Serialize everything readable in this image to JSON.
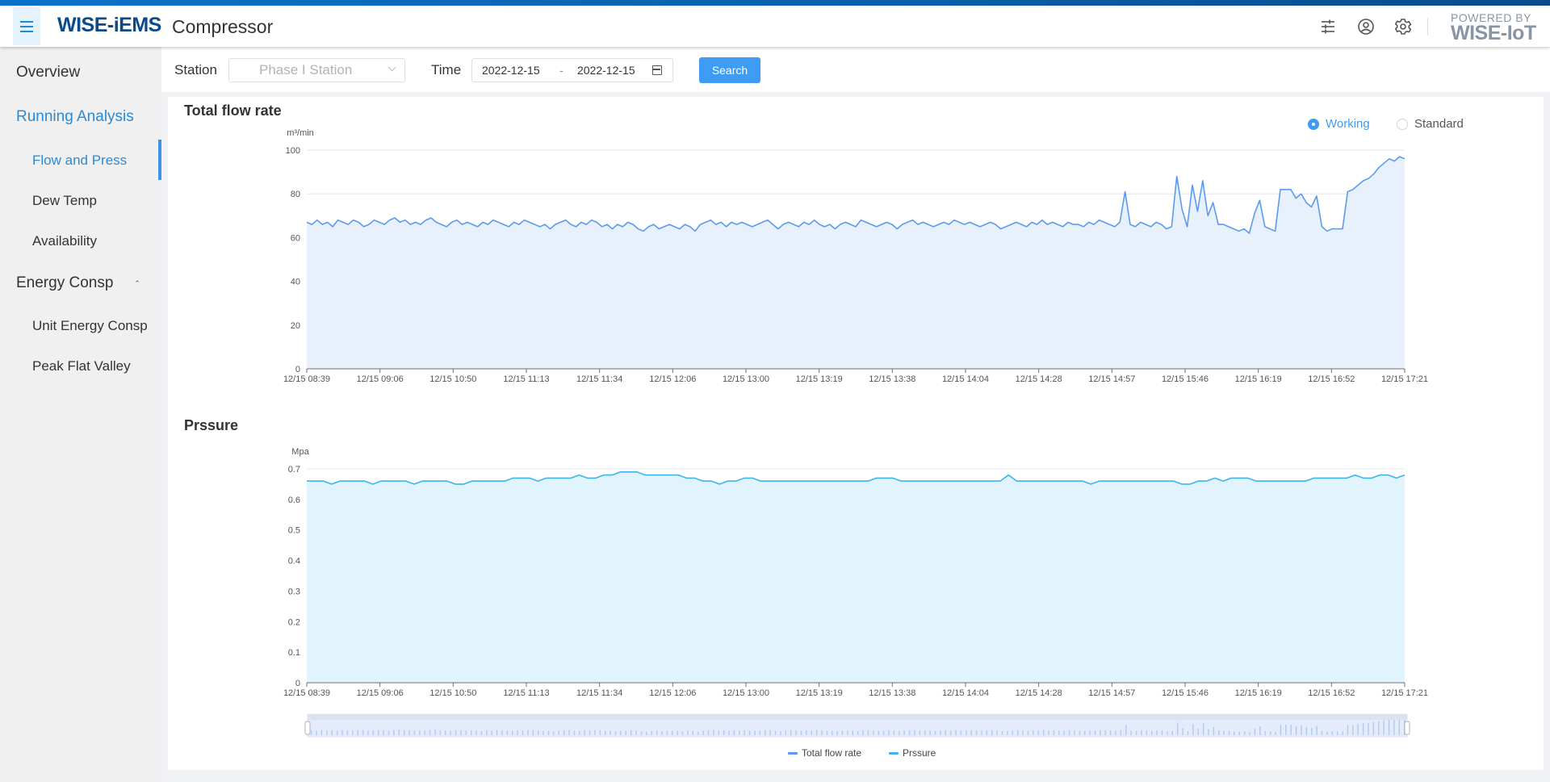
{
  "header": {
    "logo": "WISE-iEMS",
    "app_title": "Compressor",
    "powered_line1": "POWERED BY",
    "powered_line2": "WISE-IoT",
    "icons": [
      "menu-icon",
      "sliders-icon",
      "user-circle-icon",
      "gear-icon"
    ]
  },
  "sidebar": {
    "items": [
      {
        "label": "Overview",
        "type": "section"
      },
      {
        "label": "Running Analysis",
        "type": "section",
        "active": true
      },
      {
        "label": "Flow and Press",
        "type": "sub",
        "active": true
      },
      {
        "label": "Dew Temp",
        "type": "sub"
      },
      {
        "label": "Availability",
        "type": "sub"
      },
      {
        "label": "Energy Consp",
        "type": "section",
        "expanded": true
      },
      {
        "label": "Unit Energy Consp",
        "type": "sub"
      },
      {
        "label": "Peak Flat Valley",
        "type": "sub"
      }
    ]
  },
  "filters": {
    "station_label": "Station",
    "station_value": "Phase I Station",
    "time_label": "Time",
    "date_start": "2022-12-15",
    "date_sep": "-",
    "date_end": "2022-12-15",
    "search_label": "Search"
  },
  "mode": {
    "options": [
      "Working",
      "Standard"
    ],
    "selected": "Working"
  },
  "colors": {
    "accent": "#3e9cf2",
    "flow_line": "#5b9bef",
    "flow_fill": "#e8f0fc",
    "pressure_line": "#3bb4ef",
    "pressure_fill": "#e1f3fc",
    "active_nav": "#2b8ad6"
  },
  "chart_data": [
    {
      "type": "area",
      "title": "Total flow rate",
      "ylabel": "m³/min",
      "ylim": [
        0,
        100
      ],
      "yticks": [
        0,
        20,
        40,
        60,
        80,
        100
      ],
      "x_tick_labels": [
        "12/15 08:39",
        "12/15 09:06",
        "12/15 10:50",
        "12/15 11:13",
        "12/15 11:34",
        "12/15 12:06",
        "12/15 13:00",
        "12/15 13:19",
        "12/15 13:38",
        "12/15 14:04",
        "12/15 14:28",
        "12/15 14:57",
        "12/15 15:46",
        "12/15 16:19",
        "12/15 16:52",
        "12/15 17:21"
      ],
      "grid": true,
      "series": [
        {
          "name": "Total flow rate",
          "values": [
            67,
            66,
            68,
            66,
            67,
            65,
            68,
            67,
            66,
            68,
            67,
            65,
            66,
            68,
            67,
            66,
            68,
            69,
            67,
            68,
            66,
            67,
            66,
            68,
            69,
            67,
            66,
            65,
            67,
            68,
            66,
            67,
            66,
            65,
            67,
            66,
            68,
            67,
            66,
            65,
            67,
            66,
            68,
            67,
            66,
            65,
            66,
            64,
            66,
            67,
            68,
            66,
            65,
            67,
            66,
            68,
            67,
            65,
            66,
            64,
            66,
            65,
            67,
            66,
            64,
            63,
            65,
            66,
            64,
            65,
            66,
            65,
            64,
            66,
            65,
            63,
            66,
            67,
            68,
            66,
            67,
            65,
            67,
            66,
            67,
            66,
            65,
            66,
            67,
            68,
            66,
            64,
            66,
            67,
            66,
            65,
            67,
            66,
            68,
            66,
            65,
            66,
            64,
            66,
            67,
            66,
            65,
            68,
            67,
            66,
            65,
            66,
            67,
            66,
            64,
            66,
            67,
            68,
            66,
            67,
            66,
            65,
            66,
            67,
            66,
            68,
            67,
            66,
            67,
            66,
            65,
            66,
            67,
            66,
            64,
            65,
            66,
            67,
            66,
            65,
            67,
            66,
            68,
            66,
            67,
            66,
            65,
            67,
            66,
            66,
            65,
            67,
            66,
            68,
            67,
            66,
            65,
            67,
            81,
            66,
            65,
            67,
            66,
            65,
            67,
            66,
            64,
            65,
            88,
            73,
            65,
            84,
            72,
            86,
            70,
            76,
            66,
            66,
            65,
            64,
            63,
            64,
            62,
            71,
            77,
            65,
            64,
            63,
            82,
            82,
            82,
            78,
            80,
            76,
            74,
            79,
            65,
            63,
            64,
            64,
            64,
            81,
            82,
            84,
            86,
            87,
            89,
            92,
            94,
            96,
            95,
            97,
            96
          ]
        }
      ]
    },
    {
      "type": "area",
      "title": "Prssure",
      "ylabel": "Mpa",
      "ylim": [
        0,
        0.7
      ],
      "yticks": [
        0,
        0.1,
        0.2,
        0.3,
        0.4,
        0.5,
        0.6,
        0.7
      ],
      "x_tick_labels": [
        "12/15 08:39",
        "12/15 09:06",
        "12/15 10:50",
        "12/15 11:13",
        "12/15 11:34",
        "12/15 12:06",
        "12/15 13:00",
        "12/15 13:19",
        "12/15 13:38",
        "12/15 14:04",
        "12/15 14:28",
        "12/15 14:57",
        "12/15 15:46",
        "12/15 16:19",
        "12/15 16:52",
        "12/15 17:21"
      ],
      "grid": true,
      "series": [
        {
          "name": "Prssure",
          "values": [
            0.66,
            0.66,
            0.66,
            0.65,
            0.66,
            0.66,
            0.66,
            0.66,
            0.65,
            0.66,
            0.66,
            0.66,
            0.66,
            0.65,
            0.66,
            0.66,
            0.66,
            0.66,
            0.65,
            0.65,
            0.66,
            0.66,
            0.66,
            0.66,
            0.66,
            0.67,
            0.67,
            0.67,
            0.66,
            0.67,
            0.67,
            0.67,
            0.67,
            0.68,
            0.67,
            0.67,
            0.68,
            0.68,
            0.69,
            0.69,
            0.69,
            0.68,
            0.68,
            0.68,
            0.68,
            0.68,
            0.67,
            0.67,
            0.66,
            0.66,
            0.65,
            0.66,
            0.66,
            0.67,
            0.67,
            0.66,
            0.66,
            0.66,
            0.66,
            0.66,
            0.66,
            0.66,
            0.66,
            0.66,
            0.66,
            0.66,
            0.66,
            0.66,
            0.66,
            0.67,
            0.67,
            0.67,
            0.66,
            0.66,
            0.66,
            0.66,
            0.66,
            0.66,
            0.66,
            0.66,
            0.66,
            0.66,
            0.66,
            0.66,
            0.66,
            0.68,
            0.66,
            0.66,
            0.66,
            0.66,
            0.66,
            0.66,
            0.66,
            0.66,
            0.66,
            0.65,
            0.66,
            0.66,
            0.66,
            0.66,
            0.66,
            0.66,
            0.66,
            0.66,
            0.66,
            0.66,
            0.65,
            0.65,
            0.66,
            0.66,
            0.67,
            0.66,
            0.67,
            0.67,
            0.67,
            0.66,
            0.66,
            0.66,
            0.66,
            0.66,
            0.66,
            0.66,
            0.67,
            0.67,
            0.67,
            0.67,
            0.67,
            0.68,
            0.67,
            0.67,
            0.68,
            0.68,
            0.67,
            0.68
          ]
        }
      ]
    }
  ],
  "legend": {
    "items": [
      "Total flow rate",
      "Prssure"
    ],
    "placement": "bottom-center"
  },
  "datazoom": {
    "range_start_percent": 0,
    "range_end_percent": 100
  }
}
